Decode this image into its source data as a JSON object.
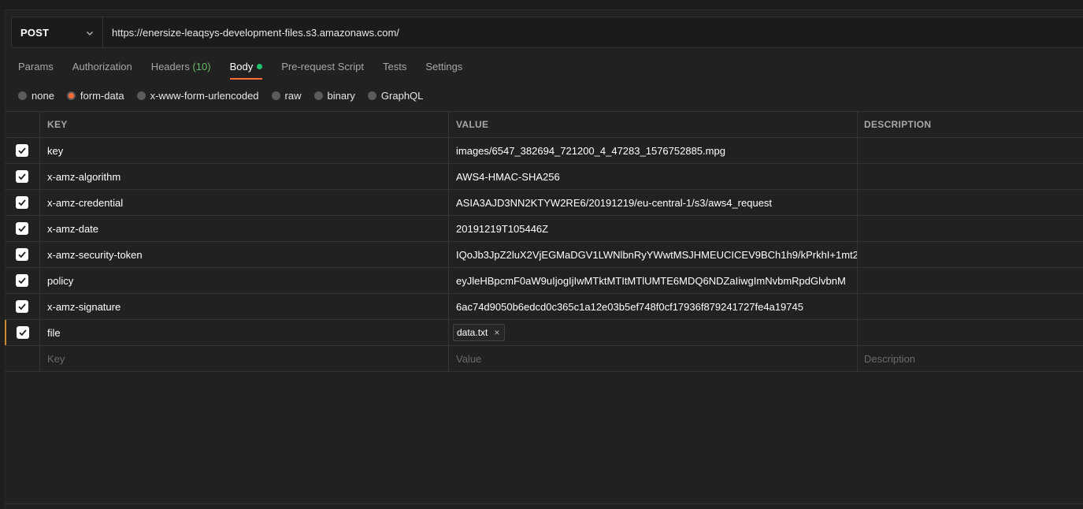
{
  "request": {
    "method": "POST",
    "url": "https://enersize-leaqsys-development-files.s3.amazonaws.com/"
  },
  "tabs": [
    {
      "label": "Params"
    },
    {
      "label": "Authorization"
    },
    {
      "label": "Headers",
      "count": "(10)"
    },
    {
      "label": "Body",
      "active": true
    },
    {
      "label": "Pre-request Script"
    },
    {
      "label": "Tests"
    },
    {
      "label": "Settings"
    }
  ],
  "body_types": [
    {
      "label": "none"
    },
    {
      "label": "form-data",
      "selected": true
    },
    {
      "label": "x-www-form-urlencoded"
    },
    {
      "label": "raw"
    },
    {
      "label": "binary"
    },
    {
      "label": "GraphQL"
    }
  ],
  "table": {
    "headers": {
      "key": "KEY",
      "value": "VALUE",
      "description": "DESCRIPTION"
    },
    "rows": [
      {
        "key": "key",
        "value": "images/6547_382694_721200_4_47283_1576752885.mpg",
        "checked": true
      },
      {
        "key": "x-amz-algorithm",
        "value": "AWS4-HMAC-SHA256",
        "checked": true
      },
      {
        "key": "x-amz-credential",
        "value": "ASIA3AJD3NN2KTYW2RE6/20191219/eu-central-1/s3/aws4_request",
        "checked": true
      },
      {
        "key": "x-amz-date",
        "value": "20191219T105446Z",
        "checked": true
      },
      {
        "key": "x-amz-security-token",
        "value": "IQoJb3JpZ2luX2VjEGMaDGV1LWNlbnRyYWwtMSJHMEUCICEV9BCh1h9/kPrkhI+1mt2",
        "checked": true
      },
      {
        "key": "policy",
        "value": "eyJleHBpcmF0aW9uIjogIjIwMTktMTItMTlUMTE6MDQ6NDZaIiwgImNvbmRpdGlvbnM",
        "checked": true
      },
      {
        "key": "x-amz-signature",
        "value": "6ac74d9050b6edcd0c365c1a12e03b5ef748f0cf17936f879241727fe4a19745",
        "checked": true
      }
    ],
    "file_row": {
      "key": "file",
      "file_name": "data.txt",
      "remove_glyph": "×",
      "checked": true
    },
    "placeholders": {
      "key": "Key",
      "value": "Value",
      "description": "Description"
    }
  },
  "colors": {
    "accent": "#ff6c37",
    "active_dot": "#1ec26d",
    "header_count": "#6cb86a"
  },
  "icons": {
    "method_dropdown": "chevron-down-icon",
    "checkbox": "checkmark-icon",
    "chip_remove": "close-icon"
  }
}
